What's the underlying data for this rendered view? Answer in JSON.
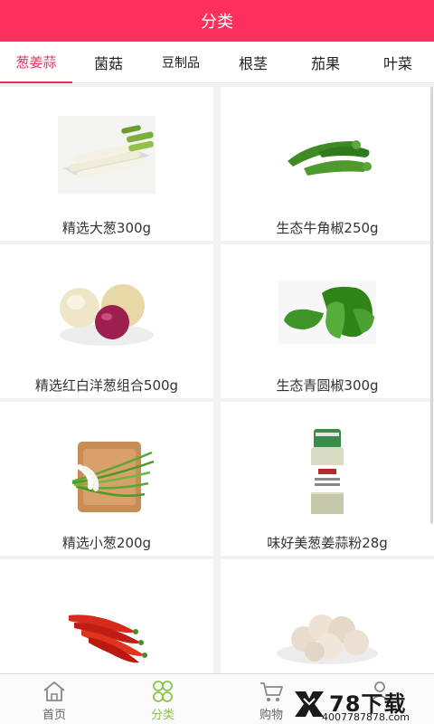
{
  "header": {
    "title": "分类"
  },
  "tabs": [
    {
      "label": "葱姜蒜",
      "active": true
    },
    {
      "label": "菌菇"
    },
    {
      "label": "豆制品"
    },
    {
      "label": "根茎"
    },
    {
      "label": "茄果"
    },
    {
      "label": "叶菜"
    }
  ],
  "products": [
    {
      "name": "精选大葱300g",
      "icon": "green-onion-stalks"
    },
    {
      "name": "生态牛角椒250g",
      "icon": "green-horn-peppers"
    },
    {
      "name": "精选红白洋葱组合500g",
      "icon": "red-and-white-onions"
    },
    {
      "name": "生态青圆椒300g",
      "icon": "green-bell-peppers"
    },
    {
      "name": "精选小葱200g",
      "icon": "scallions-on-board"
    },
    {
      "name": "味好美葱姜蒜粉28g",
      "icon": "spice-bottle"
    },
    {
      "name": "",
      "icon": "red-chili-peppers"
    },
    {
      "name": "",
      "icon": "garlic-bulbs"
    }
  ],
  "bottom_nav": [
    {
      "label": "首页",
      "icon": "home-icon"
    },
    {
      "label": "分类",
      "icon": "category-icon",
      "active": true
    },
    {
      "label": "购物",
      "icon": "cart-icon"
    },
    {
      "label": "",
      "icon": "user-icon"
    }
  ],
  "watermark": {
    "brand": "78下载",
    "url": "4007787878.com"
  },
  "colors": {
    "header": "#fe2e5d",
    "tab_active": "#e0365e",
    "nav_active": "#8bc34a"
  }
}
